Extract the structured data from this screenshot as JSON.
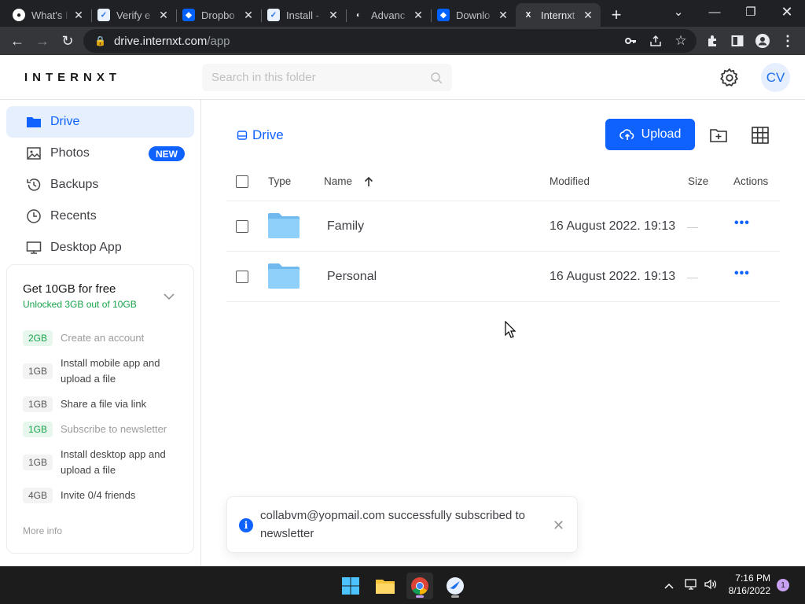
{
  "browser": {
    "tabs": [
      {
        "title": "What's I",
        "favicon": "github-icon"
      },
      {
        "title": "Verify e",
        "favicon": "internxt-bird-icon"
      },
      {
        "title": "Dropbo",
        "favicon": "dropbox-icon"
      },
      {
        "title": "Install -",
        "favicon": "internxt-bird-icon"
      },
      {
        "title": "Advanc",
        "favicon": "generic-icon"
      },
      {
        "title": "Downlo",
        "favicon": "dropbox-icon"
      },
      {
        "title": "Internxt",
        "favicon": "internxt-x-icon",
        "active": true
      }
    ],
    "url_host": "drive.internxt.com",
    "url_path": "/app"
  },
  "header": {
    "logo": "INTERNXT",
    "search_placeholder": "Search in this folder",
    "avatar_initials": "CV"
  },
  "sidebar": {
    "items": [
      {
        "label": "Drive",
        "icon": "folder-icon",
        "active": true
      },
      {
        "label": "Photos",
        "icon": "image-icon",
        "badge": "NEW"
      },
      {
        "label": "Backups",
        "icon": "history-icon"
      },
      {
        "label": "Recents",
        "icon": "clock-icon"
      },
      {
        "label": "Desktop App",
        "icon": "desktop-icon"
      }
    ],
    "promo": {
      "title": "Get 10GB for free",
      "subtitle": "Unlocked 3GB out of 10GB",
      "tasks": [
        {
          "gb": "2GB",
          "label": "Create an account",
          "done": true
        },
        {
          "gb": "1GB",
          "label": "Install mobile app and upload a file",
          "done": false
        },
        {
          "gb": "1GB",
          "label": "Share a file via link",
          "done": false
        },
        {
          "gb": "1GB",
          "label": "Subscribe to newsletter",
          "done": true
        },
        {
          "gb": "1GB",
          "label": "Install desktop app and upload a file",
          "done": false
        },
        {
          "gb": "4GB",
          "label": "Invite 0/4 friends",
          "done": false
        }
      ],
      "more_info": "More info"
    }
  },
  "main": {
    "breadcrumb": "Drive",
    "upload_label": "Upload",
    "columns": {
      "type": "Type",
      "name": "Name",
      "modified": "Modified",
      "size": "Size",
      "actions": "Actions"
    },
    "rows": [
      {
        "name": "Family",
        "modified": "16 August 2022. 19:13",
        "size": "—",
        "actions": "•••"
      },
      {
        "name": "Personal",
        "modified": "16 August 2022. 19:13",
        "size": "—",
        "actions": "•••"
      }
    ]
  },
  "toast": {
    "message": "collabvm@yopmail.com successfully subscribed to newsletter",
    "info_glyph": "i"
  },
  "taskbar": {
    "time": "7:16 PM",
    "date": "8/16/2022",
    "notifications": "1"
  }
}
